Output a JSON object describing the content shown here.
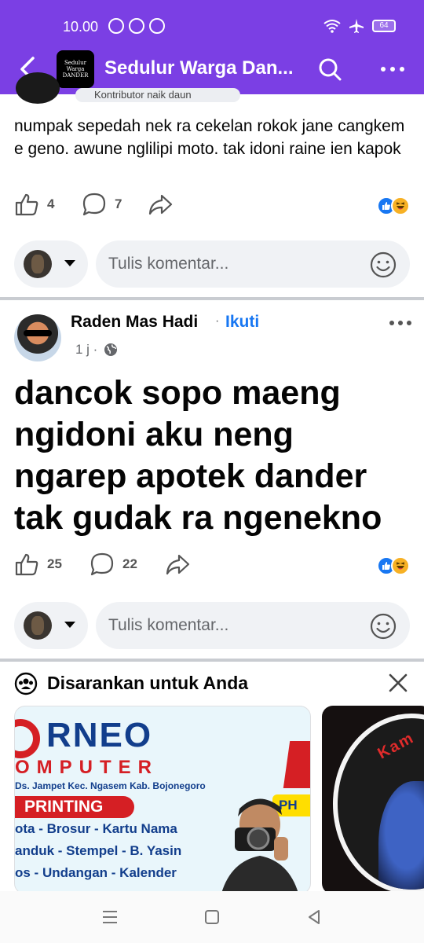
{
  "status_bar": {
    "time": "10.00",
    "battery": "64"
  },
  "header": {
    "group_title": "Sedulur Warga Dan...",
    "group_avatar_line1": "Sedulur Warga",
    "group_avatar_line2": "DANDER",
    "icons": [
      "back-arrow-icon",
      "search-icon",
      "more-icon"
    ]
  },
  "post1": {
    "badge": "Kontributor naik daun",
    "text": "numpak sepedah nek ra cekelan rokok jane cangkem e geno. awune nglilipi moto. tak idoni raine ien kapok",
    "likes": "4",
    "comments": "7"
  },
  "comment_box": {
    "placeholder": "Tulis komentar..."
  },
  "post2": {
    "author": "Raden Mas Hadi",
    "separator": "·",
    "follow": "Ikuti",
    "time": "1 j ·",
    "text": "dancok sopo maeng ngidoni aku neng ngarep apotek dander tak gudak ra ngenekno",
    "likes": "25",
    "comments": "22"
  },
  "suggested": {
    "title": "Disarankan untuk Anda",
    "card1": {
      "brand": "RNEO",
      "sub": "OMPUTER",
      "address": "Ds. Jampet Kec. Ngasem Kab. Bojonegoro",
      "printing": "PRINTING",
      "ph": "PH",
      "lines": [
        "ota - Brosur - Kartu Nama",
        "anduk - Stempel - B. Yasin",
        "os - Undangan - Kalender"
      ]
    },
    "card2": {
      "text": "Kam"
    }
  },
  "colors": {
    "header_bg": "#7b3fe4",
    "link": "#1877f2",
    "divider": "#c9ccd1"
  }
}
